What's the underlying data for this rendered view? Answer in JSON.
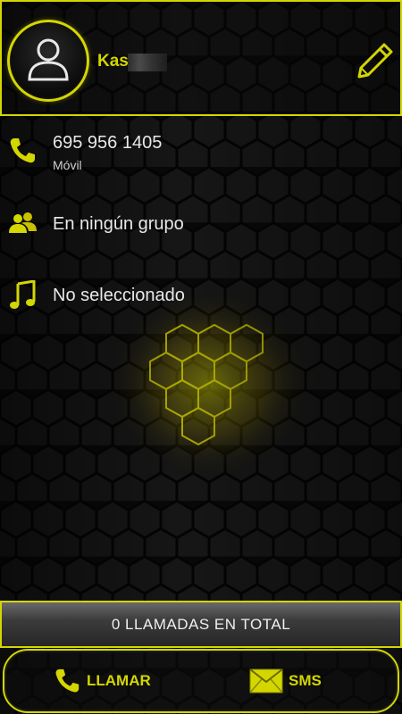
{
  "theme": {
    "accent": "#d4d600",
    "background": "#0a0a0a",
    "text": "#e8e8e8"
  },
  "header": {
    "avatar_icon": "person-silhouette-icon",
    "name_visible": "Kas",
    "edit_icon": "pencil-icon"
  },
  "phone": {
    "icon": "phone-icon",
    "number": "695 956 1405",
    "type": "Móvil"
  },
  "group": {
    "icon": "group-icon",
    "label": "En ningún grupo"
  },
  "ringtone": {
    "icon": "music-note-icon",
    "label": "No seleccionado"
  },
  "calls": {
    "total_label": "0 LLAMADAS EN TOTAL"
  },
  "actions": {
    "call": {
      "icon": "phone-icon",
      "label": "LLAMAR"
    },
    "sms": {
      "icon": "envelope-icon",
      "label": "SMS"
    }
  }
}
